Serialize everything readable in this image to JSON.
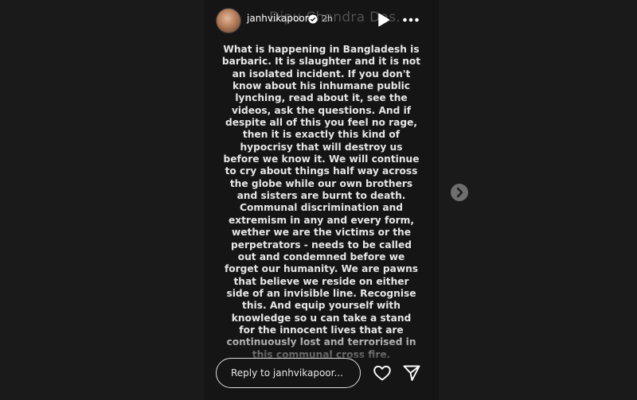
{
  "header": {
    "username": "janhvikapoor",
    "time": "2h",
    "ghost_caption": "Dipu Chandra Das.",
    "verified_icon": "verified-badge-icon",
    "play_icon": "play-icon",
    "more_icon": "more-options-icon"
  },
  "story": {
    "text": "What is happening in Bangladesh is\nbarbaric. It is slaughter and it is not\nan isolated incident. If you don't\nknow about his inhumane public\nlynching, read about it, see the\nvideos, ask the questions. And if\ndespite all of this you feel no rage,\nthen it is exactly this kind of\nhypocrisy that will destroy us\nbefore we know it. We will continue\nto cry about things half way across\nthe globe while our own brothers\nand sisters are burnt to death.\nCommunal discrimination and\nextremism in any and every form,\nwether we are the victims or the\nperpetrators - needs to be called\nout and condemned before we\nforget our humanity. We are pawns\nthat believe we reside on either\nside of  an invisible line. Recognise\nthis. And equip yourself with\nknowledge so u can take a stand\nfor the innocent lives that are\ncontinuously lost and terrorised in\nthis communal cross fire."
  },
  "footer": {
    "reply_placeholder": "Reply to janhvikapoor...",
    "like_icon": "heart-icon",
    "share_icon": "send-icon"
  },
  "navigation": {
    "next_icon": "chevron-right-icon"
  },
  "colors": {
    "page_background": "#1a1a1a",
    "story_background": "#151515",
    "text": "#e6e6e6"
  }
}
